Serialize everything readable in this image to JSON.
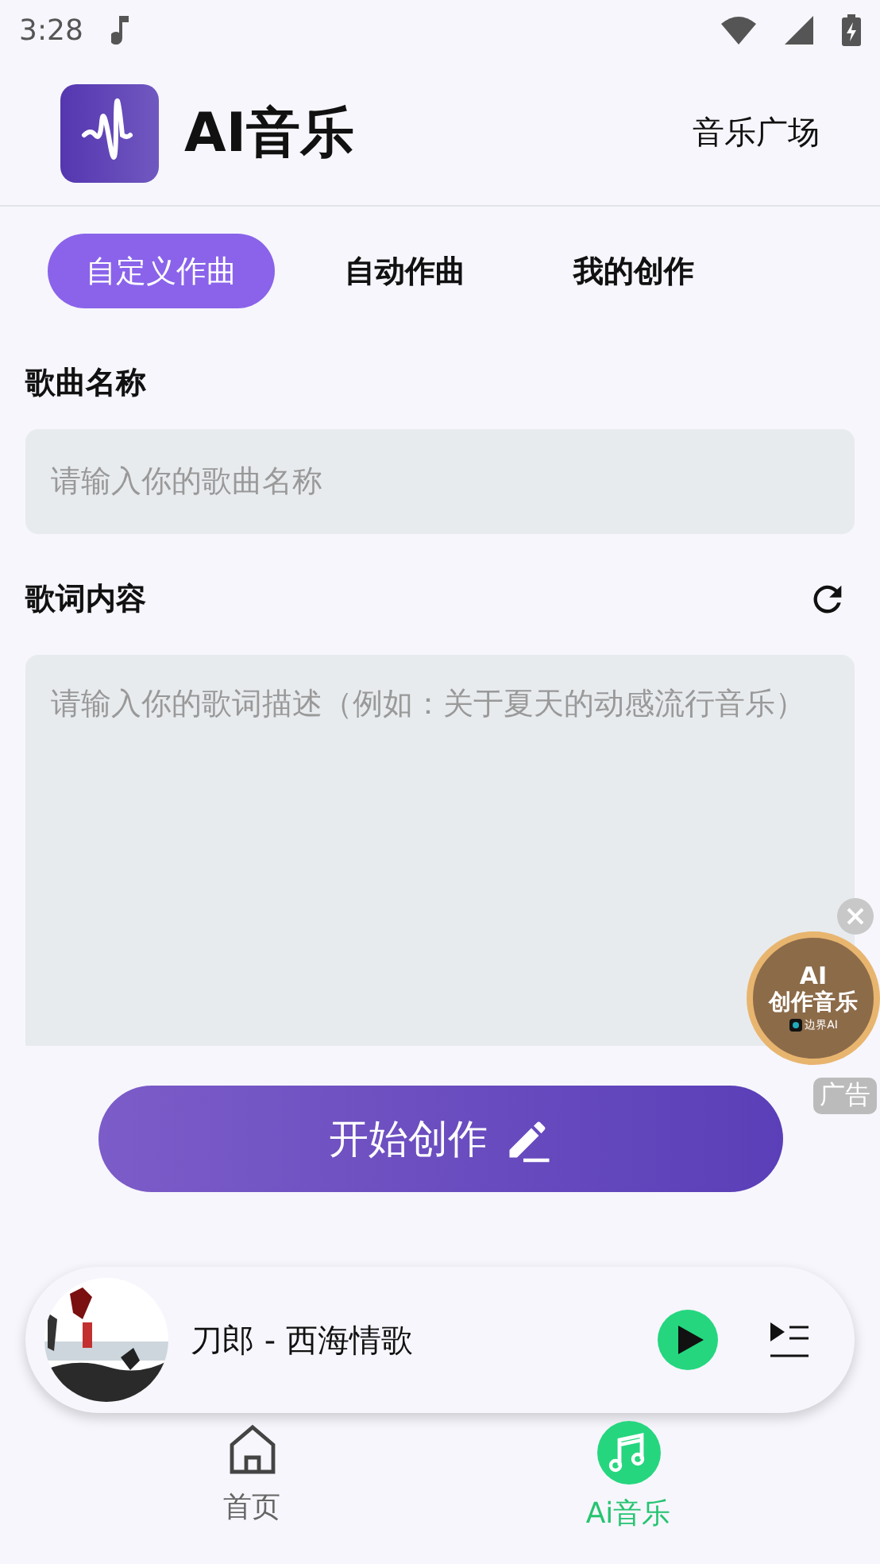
{
  "status_bar": {
    "time": "3:28"
  },
  "header": {
    "app_title": "AI音乐",
    "link": "音乐广场"
  },
  "tabs": [
    {
      "label": "自定义作曲",
      "selected": true
    },
    {
      "label": "自动作曲",
      "selected": false
    },
    {
      "label": "我的创作",
      "selected": false
    }
  ],
  "song_name": {
    "label": "歌曲名称",
    "placeholder": "请输入你的歌曲名称"
  },
  "lyrics": {
    "label": "歌词内容",
    "placeholder": "请输入你的歌词描述（例如：关于夏天的动感流行音乐）"
  },
  "create_button": {
    "label": "开始创作"
  },
  "ad": {
    "title": "AI",
    "subtitle": "创作音乐",
    "brand": "边界AI",
    "tag": "广告"
  },
  "player": {
    "track": "刀郎 - 西海情歌",
    "playing": false
  },
  "bottom_nav": [
    {
      "label": "首页",
      "selected": false
    },
    {
      "label": "Ai音乐",
      "selected": true
    }
  ]
}
